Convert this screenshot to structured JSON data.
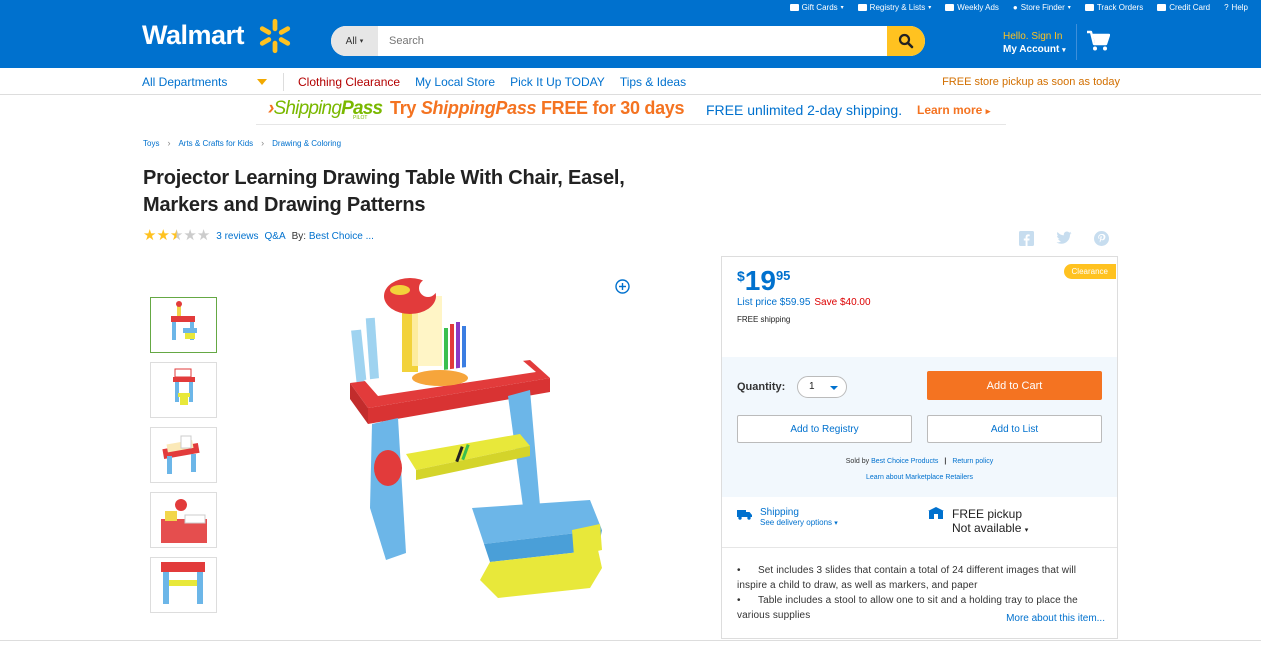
{
  "header": {
    "logo": "Walmart",
    "top_links": [
      {
        "label": "Gift Cards",
        "caret": true
      },
      {
        "label": "Registry & Lists",
        "caret": true
      },
      {
        "label": "Weekly Ads",
        "caret": false
      },
      {
        "label": "Store Finder",
        "caret": true
      },
      {
        "label": "Track Orders",
        "caret": false
      },
      {
        "label": "Credit Card",
        "caret": false
      },
      {
        "label": "Help",
        "caret": false
      }
    ],
    "search": {
      "dept": "All",
      "placeholder": "Search"
    },
    "account": {
      "hello": "Hello. Sign In",
      "my_account": "My Account"
    },
    "colors": {
      "brand_blue": "#0071ce",
      "spark_yellow": "#ffc220"
    }
  },
  "nav": {
    "departments": "All Departments",
    "links": [
      {
        "label": "Clothing Clearance",
        "highlight": true
      },
      {
        "label": "My Local Store",
        "highlight": false
      },
      {
        "label": "Pick It Up TODAY",
        "highlight": false
      },
      {
        "label": "Tips & Ideas",
        "highlight": false
      }
    ],
    "promo": "FREE store pickup as soon as today"
  },
  "banner": {
    "logo_a": "Shipping",
    "logo_b": "Pass",
    "pilot": "PILOT",
    "try": "Try ",
    "try_brand": "ShippingPass",
    "try_rest": " FREE for 30 days",
    "free": "FREE unlimited 2-day shipping.",
    "learn": "Learn more"
  },
  "breadcrumb": [
    "Toys",
    "Arts & Crafts for Kids",
    "Drawing & Coloring"
  ],
  "product": {
    "title": "Projector Learning Drawing Table With Chair, Easel, Markers and Drawing Patterns",
    "rating": 2.5,
    "reviews": "3 reviews",
    "qa": "Q&A",
    "by_label": "By:",
    "brand": "Best Choice ..."
  },
  "buybox": {
    "badge": "Clearance",
    "currency": "$",
    "dollars": "19",
    "cents": "95",
    "list_price": "List price $59.95",
    "save": "Save $40.00",
    "free_shipping": "FREE shipping",
    "qty_label": "Quantity:",
    "qty_value": "1",
    "add_to_cart": "Add to Cart",
    "add_to_registry": "Add to Registry",
    "add_to_list": "Add to List",
    "sold_by_label": "Sold by",
    "seller": "Best Choice Products",
    "return_policy": "Return policy",
    "learn_marketplace": "Learn about Marketplace Retailers",
    "shipping_title": "Shipping",
    "shipping_sub": "See delivery options",
    "pickup_title": "FREE pickup",
    "pickup_sub": "Not available",
    "bullets": [
      "Set includes 3 slides that contain a total of 24 different images that will inspire a child to draw, as well as markers, and paper",
      "Table includes a stool to allow one to sit and a holding tray to place the various supplies"
    ],
    "more": "More about this item..."
  }
}
